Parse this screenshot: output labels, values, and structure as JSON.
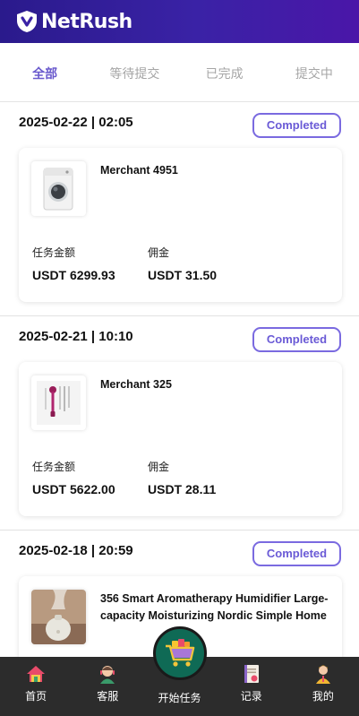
{
  "header": {
    "brand": "NetRush"
  },
  "tabs": [
    {
      "label": "全部",
      "active": true
    },
    {
      "label": "等待提交",
      "active": false
    },
    {
      "label": "已完成",
      "active": false
    },
    {
      "label": "提交中",
      "active": false
    }
  ],
  "orders": [
    {
      "datetime": "2025-02-22 | 02:05",
      "status": "Completed",
      "merchant": "Merchant 4951",
      "product_image": "washing-machine",
      "amount_label": "任务金额",
      "amount": "USDT 6299.93",
      "commission_label": "佣金",
      "commission": "USDT 31.50"
    },
    {
      "datetime": "2025-02-21 | 10:10",
      "status": "Completed",
      "merchant": "Merchant 325",
      "product_image": "hair-styler-set",
      "amount_label": "任务金额",
      "amount": "USDT 5622.00",
      "commission_label": "佣金",
      "commission": "USDT 28.11"
    },
    {
      "datetime": "2025-02-18 | 20:59",
      "status": "Completed",
      "merchant": "356 Smart Aromatherapy Humidifier Large-capacity Moisturizing Nordic Simple Home",
      "product_image": "humidifier"
    }
  ],
  "bottom_nav": [
    {
      "label": "首页",
      "icon": "home-icon"
    },
    {
      "label": "客服",
      "icon": "support-agent-icon"
    },
    {
      "label": "开始任务",
      "icon": "shopping-cart-icon"
    },
    {
      "label": "记录",
      "icon": "records-icon"
    },
    {
      "label": "我的",
      "icon": "profile-icon"
    }
  ],
  "colors": {
    "header_start": "#2a1a8c",
    "header_end": "#4a16a8",
    "accent": "#6a5acd",
    "nav_bg": "#2c2c2c",
    "fab": "#0f6a55"
  }
}
